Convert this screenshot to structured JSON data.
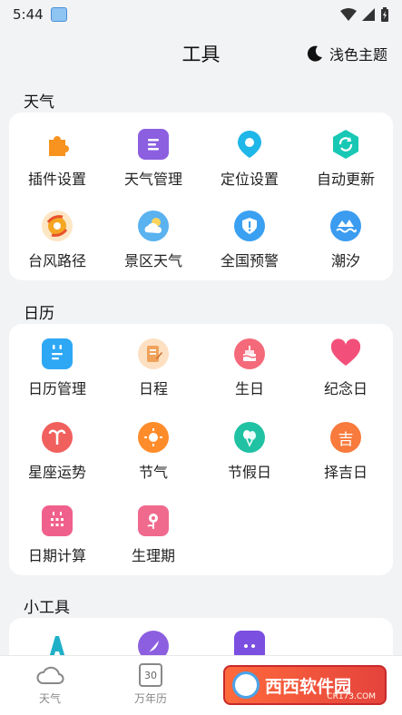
{
  "status_bar": {
    "time": "5:44"
  },
  "header": {
    "title": "工具",
    "theme_toggle_label": "浅色主题"
  },
  "sections": [
    {
      "label": "天气",
      "tools": [
        {
          "label": "插件设置",
          "icon": "puzzle-icon"
        },
        {
          "label": "天气管理",
          "icon": "list-icon"
        },
        {
          "label": "定位设置",
          "icon": "location-pin-icon"
        },
        {
          "label": "自动更新",
          "icon": "refresh-icon"
        },
        {
          "label": "台风路径",
          "icon": "typhoon-icon"
        },
        {
          "label": "景区天气",
          "icon": "cloud-sun-icon"
        },
        {
          "label": "全国预警",
          "icon": "warning-shield-icon"
        },
        {
          "label": "潮汐",
          "icon": "wave-icon"
        }
      ]
    },
    {
      "label": "日历",
      "tools": [
        {
          "label": "日历管理",
          "icon": "calendar-list-icon"
        },
        {
          "label": "日程",
          "icon": "notepad-icon"
        },
        {
          "label": "生日",
          "icon": "cake-icon"
        },
        {
          "label": "纪念日",
          "icon": "heart-icon"
        },
        {
          "label": "星座运势",
          "icon": "aries-icon"
        },
        {
          "label": "节气",
          "icon": "sun-icon"
        },
        {
          "label": "节假日",
          "icon": "balloon-icon"
        },
        {
          "label": "择吉日",
          "icon": "lucky-icon",
          "glyph": "吉"
        },
        {
          "label": "日期计算",
          "icon": "calendar-grid-icon"
        },
        {
          "label": "生理期",
          "icon": "flower-icon"
        }
      ]
    },
    {
      "label": "小工具"
    }
  ],
  "tabbar": {
    "tabs": [
      {
        "label": "天气",
        "icon": "cloud-icon"
      },
      {
        "label": "万年历",
        "icon": "calendar-icon",
        "day": "30"
      }
    ]
  },
  "watermark": {
    "text": "西西软件园",
    "sub": "CR173.COM"
  },
  "colors": {
    "puzzle": "#f7931e",
    "list": "#8c5fe0",
    "pin": "#1fb6e8",
    "refresh": "#18c8b4",
    "typhoon": "#f5a623",
    "cloudsun": "#5ab2ef",
    "shield": "#3aa0f2",
    "wave": "#3b9cf0",
    "calendar": "#2ea8f5",
    "notepad": "#f0a25b",
    "cake": "#f46a7a",
    "heart": "#f2507a",
    "aries": "#f0605d",
    "sun": "#ff8c2a",
    "balloon": "#20c2a3",
    "lucky": "#f87a3c",
    "grid": "#f0608c",
    "flower": "#f06a8e"
  }
}
